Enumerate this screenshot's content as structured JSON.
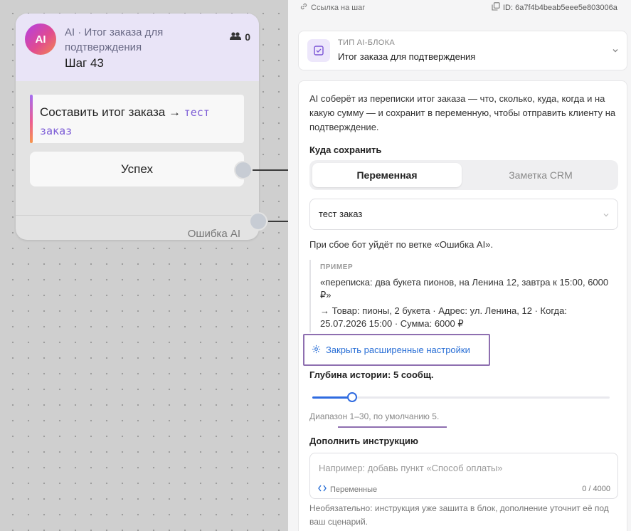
{
  "node": {
    "avatar": "AI",
    "subtitle": "AI · Итог заказа для подтверждения",
    "title": "Шаг 43",
    "users_count": "0",
    "users_icon": "users-icon",
    "prompt_prefix": "Составить итог заказа → ",
    "prompt_variable": "тест заказ",
    "success_label": "Успех",
    "error_label": "Ошибка AI"
  },
  "panel": {
    "step_link": "Ссылка на шаг",
    "step_id": "ID: 6a7f4b4beab5eee5e803006a",
    "block_type_label": "ТИП AI-БЛОКА",
    "block_type_value": "Итог заказа для подтверждения",
    "description": "AI соберёт из переписки итог заказа — что, сколько, куда, когда и на какую сумму — и сохранит в переменную, чтобы отправить клиенту на подтверждение.",
    "save_heading": "Куда сохранить",
    "save_tabs": [
      "Переменная",
      "Заметка CRM"
    ],
    "selected_variable": "тест заказ",
    "fail_note": "При сбое бот уйдёт по ветке «Ошибка AI».",
    "example": {
      "label": "ПРИМЕР",
      "input": "«переписка: два букета пионов, на Ленина 12, завтра к 15:00, 6000 ₽»",
      "output": "→ Товар: пионы, 2 букета · Адрес: ул. Ленина, 12 · Когда: 25.07.2026 15:00 · Сумма: 6000 ₽"
    },
    "advanced_toggle": "Закрыть расширенные настройки",
    "history_depth_label": "Глубина истории: 5 сообщ.",
    "history_depth": {
      "value": 5,
      "min": 1,
      "max": 30
    },
    "range_note": "Диапазон 1–30, по умолчанию 5.",
    "instruction_heading": "Дополнить инструкцию",
    "instruction_placeholder": "Например: добавь пункт «Способ оплаты»",
    "instruction_vars": "Переменные",
    "instruction_counter": "0 / 4000",
    "instruction_note": "Необязательно: инструкция уже зашита в блок, дополнение уточнит её под ваш сценарий."
  },
  "colors": {
    "accent": "#2f6be0",
    "prompt_var": "#7c5cd6",
    "highlight": "#8e6fb0",
    "node_header": "#e9e4f7"
  }
}
